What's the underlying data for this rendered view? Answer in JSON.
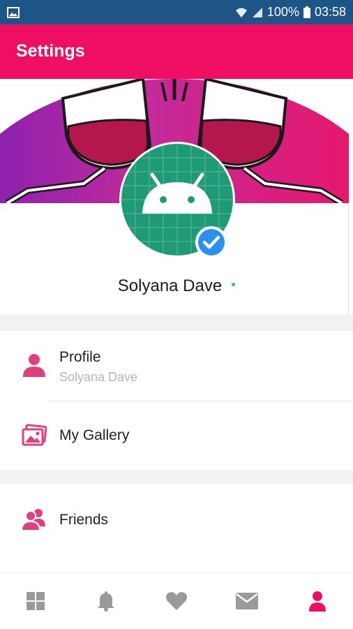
{
  "status_bar": {
    "battery_percent": "100%",
    "time": "03:58"
  },
  "toolbar": {
    "title": "Settings"
  },
  "profile": {
    "name": "Solyana Dave",
    "online": true,
    "verified": true
  },
  "menu": {
    "items": [
      {
        "title": "Profile",
        "subtitle": "Solyana Dave",
        "icon": "person-icon"
      },
      {
        "title": "My Gallery",
        "icon": "gallery-icon"
      },
      {
        "title": "Friends",
        "icon": "friends-icon"
      }
    ]
  },
  "bottom_nav": {
    "items": [
      {
        "icon": "grid-icon",
        "active": false
      },
      {
        "icon": "bell-icon",
        "active": false
      },
      {
        "icon": "heart-icon",
        "active": false
      },
      {
        "icon": "mail-icon",
        "active": false
      },
      {
        "icon": "person-icon",
        "active": true
      }
    ]
  },
  "colors": {
    "accent": "#ee0f63",
    "status_bar": "#1d5587",
    "icon_pink": "#e0407f",
    "nav_gray": "#9a9a9a",
    "verified_blue": "#2b8ff0",
    "online_green": "#1fc85b"
  }
}
